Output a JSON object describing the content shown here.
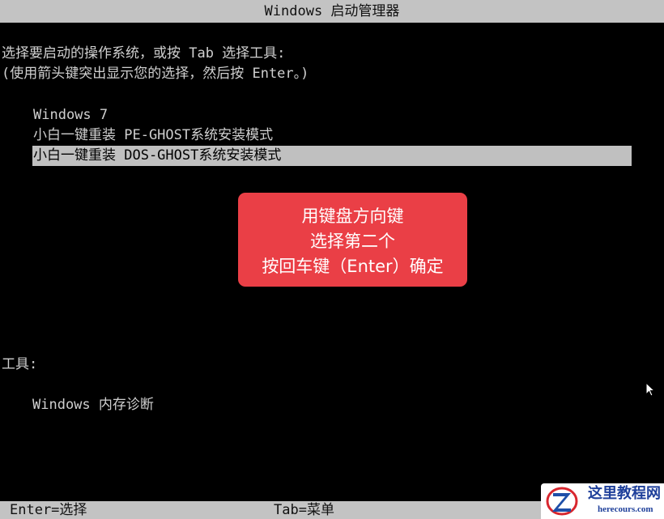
{
  "window": {
    "title": "Windows 启动管理器"
  },
  "prompt": {
    "line1": "选择要启动的操作系统，或按 Tab 选择工具:",
    "line2": "(使用箭头键突出显示您的选择，然后按 Enter。)"
  },
  "os_entries": [
    {
      "label": "Windows 7",
      "selected": false
    },
    {
      "label": "小白一键重装 PE-GHOST系统安装模式",
      "selected": false
    },
    {
      "label": "小白一键重装 DOS-GHOST系统安装模式",
      "selected": true
    }
  ],
  "callout": {
    "line1": "用键盘方向键",
    "line2": "选择第二个",
    "line3": "按回车键（Enter）确定",
    "color": "#ea3f46"
  },
  "tools": {
    "heading": "工具:",
    "items": [
      {
        "label": "Windows 内存诊断"
      }
    ]
  },
  "status_bar": {
    "enter_hint": "Enter=选择",
    "tab_hint": "Tab=菜单"
  },
  "watermark": {
    "title": "这里教程网",
    "url": "herecours.com",
    "logo_icon": "z-logo-icon"
  },
  "cursor_icon": "mouse-pointer-icon"
}
